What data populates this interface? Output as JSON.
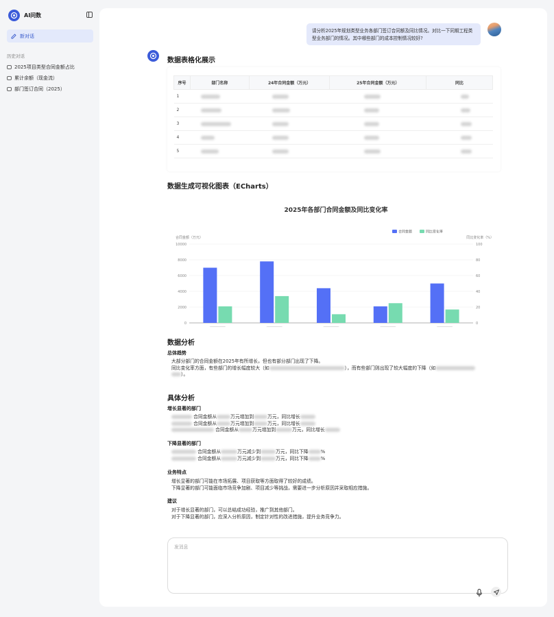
{
  "app": {
    "title": "AI问数"
  },
  "sidebar": {
    "new_chat": "新对话",
    "history_heading": "历史对话",
    "history": [
      "2025项目类型合同金额占比",
      "累计余额（现金流）",
      "部门签订合同（2025）"
    ]
  },
  "conversation": {
    "user_message": "请分析2025年规划类型业务各部门签订合同额及同比情况。对比一下同期工程类型业务部门的情况。其中哪些部门的成本控制情况较好?"
  },
  "answer": {
    "table_title": "数据表格化展示",
    "table": {
      "headers": [
        "序号",
        "部门名称",
        "24年合同金额（万元）",
        "25年合同金额（万元）",
        "同比"
      ],
      "rows": [
        [
          "1"
        ],
        [
          "2"
        ],
        [
          "3"
        ],
        [
          "4"
        ],
        [
          "5"
        ]
      ]
    },
    "chart_title": "数据生成可视化图表（ECharts）",
    "analysis_title": "数据分析",
    "overall_heading": "总体趋势",
    "overall_line1": "大部分部门的合同金额在2025年有所增长，但也有部分部门出现了下降。",
    "overall_line2a": "同比变化率方面，有些部门的增长幅度较大（如",
    "overall_line2b": "），而有些部门则出现了较大幅度的下降（如",
    "overall_line2c": "）。",
    "detail_title": "具体分析",
    "growth_heading": "增长显著的部门",
    "growth_items": [
      {
        "a": "合同金额从",
        "b": "万元增加到",
        "c": "万元，同比增长"
      },
      {
        "a": "合同金额从",
        "b": "万元增加到",
        "c": "万元，同比增长"
      },
      {
        "a": "合同金额从",
        "b": "万元增加到",
        "c": "万元，同比增长"
      }
    ],
    "decline_heading": "下降显著的部门",
    "decline_items": [
      {
        "a": "合同金额从",
        "b": "万元减少到",
        "c": "万元，同比下降",
        "d": "%"
      },
      {
        "a": "合同金额从",
        "b": "万元减少到",
        "c": "万元，同比下降",
        "d": "%"
      }
    ],
    "feature_heading": "业务特点",
    "feature_line1": "增长显著的部门可能在市场拓展、项目获取等方面取得了较好的成绩。",
    "feature_line2": "下降显著的部门可能面临市场竞争加剧、项目减少等挑战，需要进一步分析原因并采取相应措施。",
    "advice_heading": "建议",
    "advice_line1": "对于增长显著的部门，可以总结成功经验，推广到其他部门。",
    "advice_line2": "对于下降显著的部门，应深入分析原因，制定针对性的改进措施，提升业务竞争力。"
  },
  "chart_data": {
    "type": "bar",
    "title": "2025年各部门合同金额及同比变化率",
    "categories": [
      "",
      "",
      "",
      "",
      ""
    ],
    "series": [
      {
        "name": "合同金额",
        "axis": "left",
        "color": "#5470f6",
        "values": [
          7000,
          7800,
          4400,
          2100,
          5000
        ]
      },
      {
        "name": "同比变化率",
        "axis": "right",
        "color": "#77dbb0",
        "values": [
          21,
          34,
          11,
          25,
          17
        ]
      }
    ],
    "left_axis": {
      "label": "合同金额（万元）",
      "ylim": [
        0,
        10000
      ],
      "ticks": [
        0,
        2000,
        4000,
        6000,
        8000,
        10000
      ]
    },
    "right_axis": {
      "label": "同比变化率（%）",
      "ylim": [
        0,
        100
      ],
      "ticks": [
        0,
        20,
        40,
        60,
        80,
        100
      ]
    },
    "legend_position": "top-right",
    "grid": true
  },
  "input": {
    "placeholder": "发消息"
  }
}
